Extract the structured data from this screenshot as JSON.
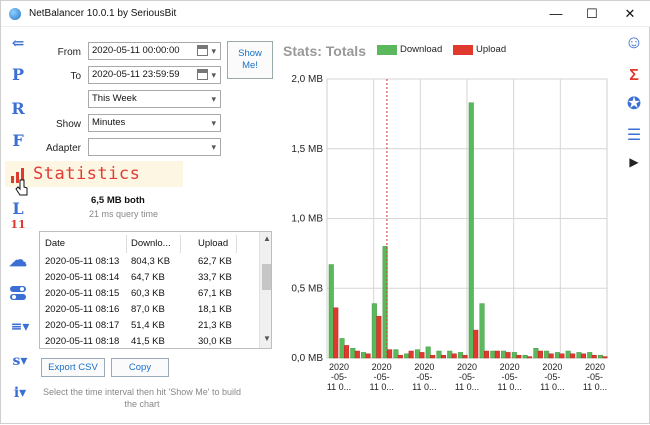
{
  "window": {
    "title": "NetBalancer 10.0.1 by SeriousBit"
  },
  "left_nav": [
    {
      "name": "back-icon",
      "glyph": "⇐"
    },
    {
      "name": "nav-p",
      "glyph": "P"
    },
    {
      "name": "nav-r",
      "glyph": "R"
    },
    {
      "name": "nav-f",
      "glyph": "F"
    },
    {
      "name": "nav-l",
      "glyph": "L"
    },
    {
      "name": "nav-11",
      "glyph": "11"
    },
    {
      "name": "cloud-icon",
      "glyph": "☁"
    },
    {
      "name": "toggle-icon",
      "glyph": "⚬"
    },
    {
      "name": "menu-icon",
      "glyph": "≡▾"
    },
    {
      "name": "nav-s",
      "glyph": "s▾"
    },
    {
      "name": "info-icon",
      "glyph": "i▾"
    }
  ],
  "right_nav": [
    {
      "name": "smiley-icon",
      "glyph": "☺"
    },
    {
      "name": "sigma-icon",
      "glyph": "Σ"
    },
    {
      "name": "award-icon",
      "glyph": "✪"
    },
    {
      "name": "list-icon",
      "glyph": "☰"
    },
    {
      "name": "play-icon",
      "glyph": "▶"
    }
  ],
  "form": {
    "from_label": "From",
    "from_value": "2020-05-11 00:00:00",
    "to_label": "To",
    "to_value": "2020-05-11 23:59:59",
    "preset_value": "This Week",
    "show_label": "Show",
    "show_value": "Minutes",
    "adapter_label": "Adapter",
    "adapter_value": "",
    "show_me_line1": "Show",
    "show_me_line2": "Me!"
  },
  "tooltip": {
    "text": "Statistics"
  },
  "summary": {
    "total": "6,5 MB both",
    "query_time": "21 ms query time"
  },
  "table": {
    "columns": [
      "Date",
      "Downlo...",
      "Upload"
    ],
    "rows": [
      {
        "date": "2020-05-11 08:13",
        "download": "804,3 KB",
        "upload": "62,7 KB"
      },
      {
        "date": "2020-05-11 08:14",
        "download": "64,7 KB",
        "upload": "33,7 KB"
      },
      {
        "date": "2020-05-11 08:15",
        "download": "60,3 KB",
        "upload": "67,1 KB"
      },
      {
        "date": "2020-05-11 08:16",
        "download": "87,0 KB",
        "upload": "18,1 KB"
      },
      {
        "date": "2020-05-11 08:17",
        "download": "51,4 KB",
        "upload": "21,3 KB"
      },
      {
        "date": "2020-05-11 08:18",
        "download": "41,5 KB",
        "upload": "30,0 KB"
      }
    ]
  },
  "buttons": {
    "export": "Export CSV",
    "copy": "Copy"
  },
  "hint": "Select the time interval then hit 'Show Me' to build the chart",
  "colors": {
    "download": "#5cb85c",
    "upload": "#e03a2e",
    "accent": "#1a70c8",
    "marker": "#c0392b"
  },
  "chart_data": {
    "type": "bar",
    "title": "Stats: Totals",
    "series": [
      {
        "name": "Download",
        "values": [
          0.67,
          0.14,
          0.07,
          0.04,
          0.39,
          0.8,
          0.06,
          0.03,
          0.06,
          0.08,
          0.05,
          0.05,
          0.04,
          1.83,
          0.39,
          0.05,
          0.05,
          0.04,
          0.02,
          0.07,
          0.05,
          0.04,
          0.05,
          0.04,
          0.04,
          0.02
        ]
      },
      {
        "name": "Upload",
        "values": [
          0.36,
          0.09,
          0.05,
          0.03,
          0.3,
          0.06,
          0.02,
          0.05,
          0.04,
          0.02,
          0.02,
          0.03,
          0.02,
          0.2,
          0.05,
          0.05,
          0.04,
          0.02,
          0.01,
          0.05,
          0.03,
          0.03,
          0.03,
          0.03,
          0.02,
          0.01
        ]
      }
    ],
    "y_ticks": [
      "0,0 MB",
      "0,5 MB",
      "1,0 MB",
      "1,5 MB",
      "2,0 MB"
    ],
    "ylim": [
      0,
      2.0
    ],
    "x_ticks": [
      [
        "2020",
        "-05-",
        "11 0..."
      ],
      [
        "2020",
        "-05-",
        "11 0..."
      ],
      [
        "2020",
        "-05-",
        "11 0..."
      ],
      [
        "2020",
        "-05-",
        "11 0..."
      ],
      [
        "2020",
        "-05-",
        "11 0..."
      ],
      [
        "2020",
        "-05-",
        "11 0..."
      ],
      [
        "2020",
        "-05-",
        "11 0..."
      ]
    ],
    "marker_index": 5,
    "grid": true
  }
}
